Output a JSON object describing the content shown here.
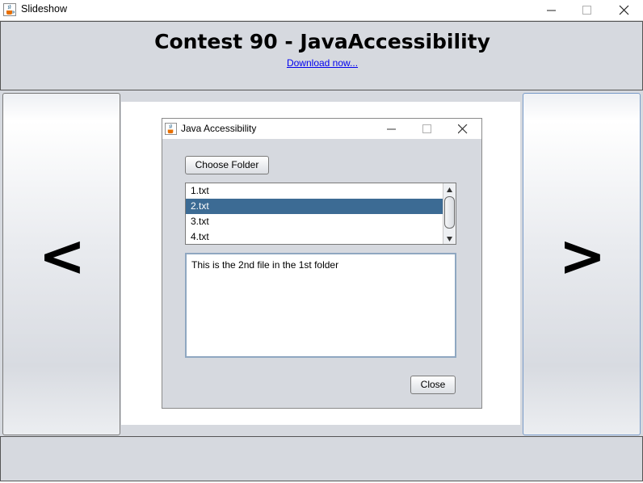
{
  "window": {
    "title": "Slideshow",
    "icon": "java-coffee-cup-icon",
    "controls": [
      "minimize-icon",
      "maximize-icon",
      "close-icon"
    ]
  },
  "header": {
    "heading": "Contest 90 - JavaAccessibility",
    "link": "Download now..."
  },
  "nav": {
    "prev_label": "<",
    "next_label": ">"
  },
  "slide": {
    "dialog": {
      "title": "Java Accessibility",
      "icon": "java-coffee-cup-icon",
      "choose_button": "Choose Folder",
      "files": [
        "1.txt",
        "2.txt",
        "3.txt",
        "4.txt"
      ],
      "selected_file": "2.txt",
      "content": "This is the 2nd file in the 1st folder",
      "close_button": "Close"
    }
  },
  "colors": {
    "panel_bg": "#d6d9df",
    "selection_bg": "#3c6b94",
    "link": "#0000ee"
  }
}
